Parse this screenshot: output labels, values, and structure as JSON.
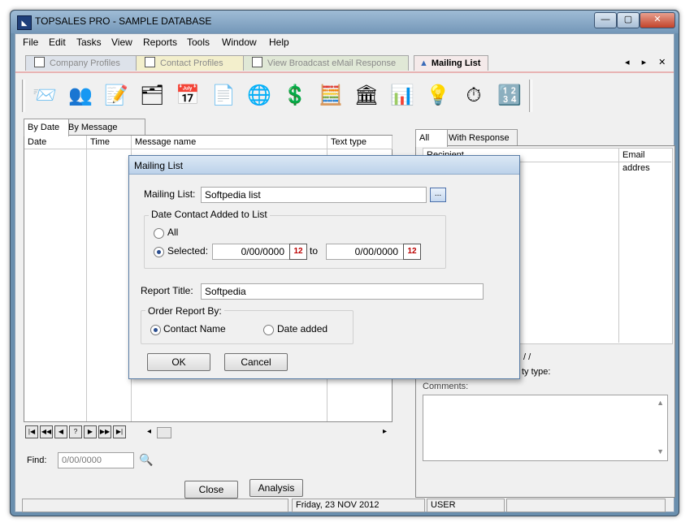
{
  "window": {
    "title": "TOPSALES PRO - SAMPLE DATABASE",
    "app_icon": "topsales-icon",
    "buttons": {
      "minimize": "—",
      "maximize": "▢",
      "close": "✕"
    }
  },
  "menu": [
    "File",
    "Edit",
    "Tasks",
    "View",
    "Reports",
    "Tools",
    "Window",
    "Help"
  ],
  "doc_tabs": [
    {
      "label": "Company Profiles",
      "active": false
    },
    {
      "label": "Contact Profiles",
      "active": false
    },
    {
      "label": "View Broadcast eMail Response",
      "active": false
    },
    {
      "label": "Mailing List",
      "active": true
    }
  ],
  "tab_nav": "◂ ▸ ✕",
  "toolbar_icons": [
    {
      "name": "envelope-stamp-icon",
      "glyph": "📨"
    },
    {
      "name": "contacts-people-icon",
      "glyph": "👥"
    },
    {
      "name": "letter-edit-icon",
      "glyph": "📝"
    },
    {
      "name": "folder-cards-icon",
      "glyph": "🗂"
    },
    {
      "name": "calendar-icon",
      "glyph": "📅"
    },
    {
      "name": "document-search-icon",
      "glyph": "📄"
    },
    {
      "name": "globe-computer-icon",
      "glyph": "🌐"
    },
    {
      "name": "dollar-document-icon",
      "glyph": "💲"
    },
    {
      "name": "cash-register-icon",
      "glyph": "🧮"
    },
    {
      "name": "bank-icon",
      "glyph": "🏛"
    },
    {
      "name": "team-chart-icon",
      "glyph": "📊"
    },
    {
      "name": "desk-lamp-icon",
      "glyph": "💡"
    },
    {
      "name": "stopwatch-icon",
      "glyph": "⏱"
    },
    {
      "name": "calculator-icon",
      "glyph": "🔢"
    }
  ],
  "left": {
    "tabs": [
      "By Date",
      "By Message Name"
    ],
    "columns": [
      "Date",
      "Time",
      "Message name",
      "Text type"
    ],
    "nav_buttons": [
      "|◀",
      "◀◀",
      "◀",
      "?",
      "▶",
      "▶▶",
      "▶|"
    ],
    "find_label": "Find:",
    "find_value": "0/00/0000",
    "close_button": "Close",
    "analysis_button": "Analysis"
  },
  "right": {
    "tabs": [
      "All",
      "With Response"
    ],
    "columns": [
      "Recipient",
      "Email addres"
    ],
    "slashes": "/ /",
    "activity_label": "ty type:",
    "comments_label": "Comments:"
  },
  "status": {
    "date": "Friday, 23 NOV 2012",
    "user": "USER"
  },
  "dialog": {
    "title": "Mailing List",
    "mailing_list_label": "Mailing List:",
    "mailing_list_value": "Softpedia list",
    "browse_button": "...",
    "date_group_title": "Date Contact Added to List",
    "radio_all": "All",
    "radio_selected": "Selected:",
    "date_from": "0/00/0000",
    "date_to": "0/00/0000",
    "to_label": "to",
    "cal_glyph": "12",
    "report_title_label": "Report Title:",
    "report_title_value": "Softpedia",
    "order_group_title": "Order Report By:",
    "order_contact": "Contact Name",
    "order_date": "Date added",
    "ok_button": "OK",
    "cancel_button": "Cancel"
  }
}
